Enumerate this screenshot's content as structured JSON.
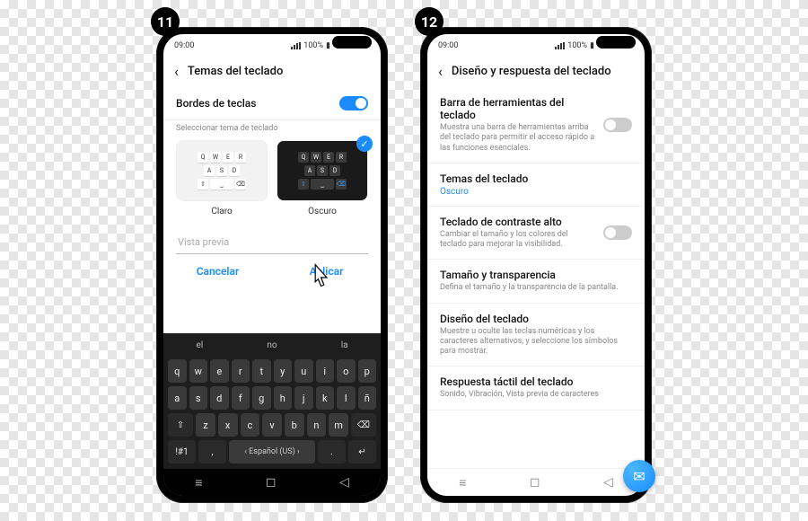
{
  "steps": {
    "s11": "11",
    "s12": "12"
  },
  "status": {
    "time": "09:00",
    "battery": "100%"
  },
  "p11": {
    "title": "Temas del teclado",
    "key_borders_label": "Bordes de teclas",
    "select_theme_label": "Seleccionar tema de teclado",
    "theme_light": "Claro",
    "theme_dark": "Oscuro",
    "preview_placeholder": "Vista previa",
    "cancel": "Cancelar",
    "apply": "Aplicar",
    "suggestions": {
      "a": "el",
      "b": "no",
      "c": "la"
    },
    "kb": {
      "r1": [
        "q",
        "w",
        "e",
        "r",
        "t",
        "y",
        "u",
        "i",
        "o",
        "p"
      ],
      "r2": [
        "a",
        "s",
        "d",
        "f",
        "g",
        "h",
        "j",
        "k",
        "l",
        "ñ"
      ],
      "r3_shift": "⇧",
      "r3": [
        "z",
        "x",
        "c",
        "v",
        "b",
        "n",
        "m"
      ],
      "r3_del": "⌫",
      "r4_sym": "!#1",
      "r4_comma": ",",
      "r4_space": "‹  Español (US)  ›",
      "r4_dot": ".",
      "r4_enter": "↵"
    }
  },
  "p12": {
    "title": "Diseño y respuesta del teclado",
    "items": {
      "toolbar_lbl": "Barra de herramientas del teclado",
      "toolbar_sub": "Muestra una barra de herramientas arriba del teclado para permitir el acceso rápido a las funciones esenciales.",
      "themes_lbl": "Temas del teclado",
      "themes_val": "Oscuro",
      "contrast_lbl": "Teclado de contraste alto",
      "contrast_sub": "Cambiar el tamaño y los colores del teclado para mejorar la visibilidad.",
      "size_lbl": "Tamaño y transparencia",
      "size_sub": "Defina el tamaño y la transparencia de la pantalla.",
      "layout_lbl": "Diseño del teclado",
      "layout_sub": "Muestre u oculte las teclas numéricas y los caracteres alternativos, y seleccione los símbolos para mostrar.",
      "feedback_lbl": "Respuesta táctil del teclado",
      "feedback_sub": "Sonido, Vibración, Vista previa de caracteres"
    }
  }
}
